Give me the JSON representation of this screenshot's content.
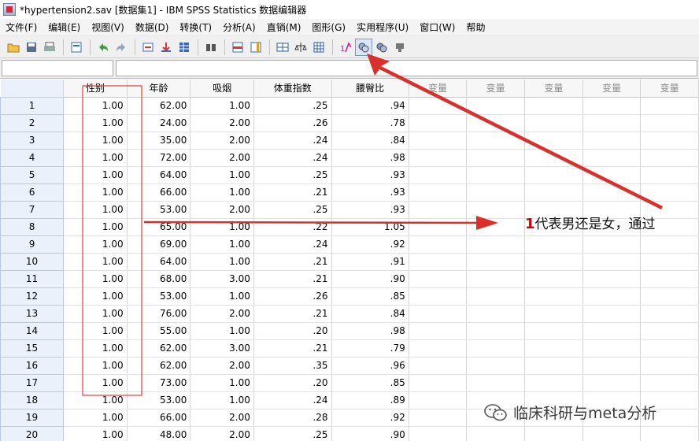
{
  "window": {
    "title": "*hypertension2.sav [数据集1] - IBM SPSS Statistics 数据编辑器"
  },
  "menu": [
    "文件(F)",
    "编辑(E)",
    "视图(V)",
    "数据(D)",
    "转换(T)",
    "分析(A)",
    "直销(M)",
    "图形(G)",
    "实用程序(U)",
    "窗口(W)",
    "帮助"
  ],
  "toolbar": {
    "icons": [
      "open-folder-icon",
      "save-icon",
      "print-icon",
      "|",
      "dialog-recall-icon",
      "|",
      "undo-icon",
      "redo-icon",
      "|",
      "goto-case-icon",
      "goto-variable-icon",
      "variables-icon",
      "|",
      "find-icon",
      "|",
      "insert-cases-icon",
      "insert-variable-icon",
      "|",
      "split-file-icon",
      "weight-cases-icon",
      "select-cases-icon",
      "|",
      "value-labels-icon",
      "use-sets-icon",
      "show-all-variables-icon",
      "spell-check-icon"
    ],
    "active": "use-sets-icon"
  },
  "columns": {
    "defined": [
      "性别",
      "年龄",
      "吸烟",
      "体重指数",
      "腰臀比"
    ],
    "empty_label": "变量",
    "empty_count": 5
  },
  "rows": [
    {
      "n": "1",
      "v": [
        "1.00",
        "62.00",
        "1.00",
        ".25",
        ".94"
      ]
    },
    {
      "n": "2",
      "v": [
        "1.00",
        "24.00",
        "2.00",
        ".26",
        ".78"
      ]
    },
    {
      "n": "3",
      "v": [
        "1.00",
        "35.00",
        "2.00",
        ".24",
        ".84"
      ]
    },
    {
      "n": "4",
      "v": [
        "1.00",
        "72.00",
        "2.00",
        ".24",
        ".98"
      ]
    },
    {
      "n": "5",
      "v": [
        "1.00",
        "64.00",
        "1.00",
        ".25",
        ".93"
      ]
    },
    {
      "n": "6",
      "v": [
        "1.00",
        "66.00",
        "1.00",
        ".21",
        ".93"
      ]
    },
    {
      "n": "7",
      "v": [
        "1.00",
        "53.00",
        "2.00",
        ".25",
        ".93"
      ]
    },
    {
      "n": "8",
      "v": [
        "1.00",
        "65.00",
        "1.00",
        ".22",
        "1.05"
      ]
    },
    {
      "n": "9",
      "v": [
        "1.00",
        "69.00",
        "1.00",
        ".24",
        ".92"
      ]
    },
    {
      "n": "10",
      "v": [
        "1.00",
        "64.00",
        "1.00",
        ".21",
        ".91"
      ]
    },
    {
      "n": "11",
      "v": [
        "1.00",
        "68.00",
        "3.00",
        ".21",
        ".90"
      ]
    },
    {
      "n": "12",
      "v": [
        "1.00",
        "53.00",
        "1.00",
        ".26",
        ".85"
      ]
    },
    {
      "n": "13",
      "v": [
        "1.00",
        "76.00",
        "2.00",
        ".21",
        ".84"
      ]
    },
    {
      "n": "14",
      "v": [
        "1.00",
        "55.00",
        "1.00",
        ".20",
        ".98"
      ]
    },
    {
      "n": "15",
      "v": [
        "1.00",
        "62.00",
        "3.00",
        ".21",
        ".79"
      ]
    },
    {
      "n": "16",
      "v": [
        "1.00",
        "62.00",
        "2.00",
        ".35",
        ".96"
      ]
    },
    {
      "n": "17",
      "v": [
        "1.00",
        "73.00",
        "1.00",
        ".20",
        ".85"
      ]
    },
    {
      "n": "18",
      "v": [
        "1.00",
        "53.00",
        "1.00",
        ".24",
        ".89"
      ]
    },
    {
      "n": "19",
      "v": [
        "1.00",
        "66.00",
        "2.00",
        ".28",
        ".92"
      ]
    },
    {
      "n": "20",
      "v": [
        "1.00",
        "48.00",
        "2.00",
        ".25",
        ".90"
      ]
    }
  ],
  "annotation": {
    "number": "1",
    "text": "代表男还是女，通过",
    "color": "#d9302c",
    "box_color": "#e0403c"
  },
  "watermark": {
    "text": "临床科研与meta分析",
    "icon": "wechat-icon"
  }
}
